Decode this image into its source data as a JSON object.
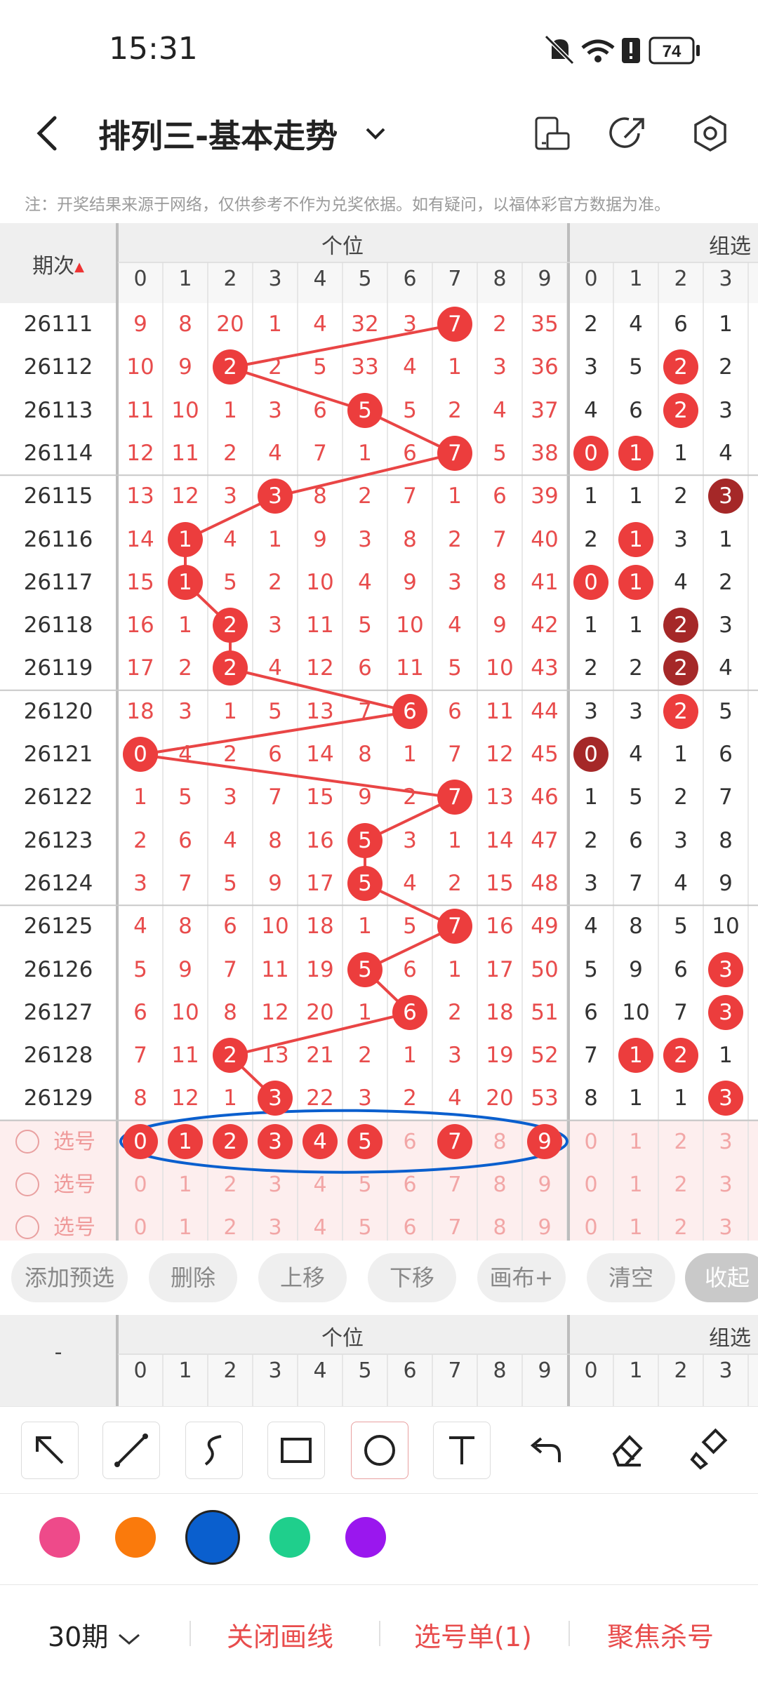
{
  "status_bar": {
    "time": "15:31",
    "battery": "74"
  },
  "header": {
    "title": "排列三-基本走势"
  },
  "note": "注：开奖结果来源于网络，仅供参考不作为兑奖依据。如有疑问，以福体彩官方数据为准。",
  "table": {
    "period_header": "期次",
    "group1_header": "个位",
    "group2_header": "组选",
    "digits": [
      "0",
      "1",
      "2",
      "3",
      "4",
      "5",
      "6",
      "7",
      "8",
      "9"
    ],
    "digits2": [
      "0",
      "1",
      "2",
      "3"
    ],
    "rows": [
      {
        "period": "26111",
        "vals": [
          "9",
          "8",
          "20",
          "1",
          "4",
          "32",
          "3",
          "7",
          "2",
          "35"
        ],
        "hit": 7,
        "vals2": [
          "2",
          "4",
          "6",
          "1"
        ],
        "hits2": []
      },
      {
        "period": "26112",
        "vals": [
          "10",
          "9",
          "2",
          "2",
          "5",
          "33",
          "4",
          "1",
          "3",
          "36"
        ],
        "hit": 2,
        "vals2": [
          "3",
          "5",
          "2",
          "2"
        ],
        "hits2": [
          2
        ]
      },
      {
        "period": "26113",
        "vals": [
          "11",
          "10",
          "1",
          "3",
          "6",
          "5",
          "5",
          "2",
          "4",
          "37"
        ],
        "hit": 5,
        "vals2": [
          "4",
          "6",
          "2",
          "3"
        ],
        "hits2": [
          2
        ]
      },
      {
        "period": "26114",
        "vals": [
          "12",
          "11",
          "2",
          "4",
          "7",
          "1",
          "6",
          "7",
          "5",
          "38"
        ],
        "hit": 7,
        "vals2": [
          "0",
          "1",
          "1",
          "4"
        ],
        "hits2": [
          0,
          1
        ]
      },
      {
        "period": "26115",
        "vals": [
          "13",
          "12",
          "3",
          "3",
          "8",
          "2",
          "7",
          "1",
          "6",
          "39"
        ],
        "hit": 3,
        "vals2": [
          "1",
          "1",
          "2",
          "3"
        ],
        "hits2": [
          3
        ],
        "dark2": [
          3
        ]
      },
      {
        "period": "26116",
        "vals": [
          "14",
          "1",
          "4",
          "1",
          "9",
          "3",
          "8",
          "2",
          "7",
          "40"
        ],
        "hit": 1,
        "vals2": [
          "2",
          "1",
          "3",
          "1"
        ],
        "hits2": [
          1
        ]
      },
      {
        "period": "26117",
        "vals": [
          "15",
          "1",
          "5",
          "2",
          "10",
          "4",
          "9",
          "3",
          "8",
          "41"
        ],
        "hit": 1,
        "vals2": [
          "0",
          "1",
          "4",
          "2"
        ],
        "hits2": [
          0,
          1
        ]
      },
      {
        "period": "26118",
        "vals": [
          "16",
          "1",
          "2",
          "3",
          "11",
          "5",
          "10",
          "4",
          "9",
          "42"
        ],
        "hit": 2,
        "vals2": [
          "1",
          "1",
          "2",
          "3"
        ],
        "hits2": [
          2
        ],
        "dark2": [
          2
        ]
      },
      {
        "period": "26119",
        "vals": [
          "17",
          "2",
          "2",
          "4",
          "12",
          "6",
          "11",
          "5",
          "10",
          "43"
        ],
        "hit": 2,
        "vals2": [
          "2",
          "2",
          "2",
          "4"
        ],
        "hits2": [
          2
        ],
        "dark2": [
          2
        ]
      },
      {
        "period": "26120",
        "vals": [
          "18",
          "3",
          "1",
          "5",
          "13",
          "7",
          "6",
          "6",
          "11",
          "44"
        ],
        "hit": 6,
        "vals2": [
          "3",
          "3",
          "2",
          "5"
        ],
        "hits2": [
          2
        ]
      },
      {
        "period": "26121",
        "vals": [
          "0",
          "4",
          "2",
          "6",
          "14",
          "8",
          "1",
          "7",
          "12",
          "45"
        ],
        "hit": 0,
        "vals2": [
          "0",
          "4",
          "1",
          "6"
        ],
        "hits2": [
          0
        ],
        "dark2": [
          0
        ]
      },
      {
        "period": "26122",
        "vals": [
          "1",
          "5",
          "3",
          "7",
          "15",
          "9",
          "2",
          "7",
          "13",
          "46"
        ],
        "hit": 7,
        "vals2": [
          "1",
          "5",
          "2",
          "7"
        ],
        "hits2": []
      },
      {
        "period": "26123",
        "vals": [
          "2",
          "6",
          "4",
          "8",
          "16",
          "5",
          "3",
          "1",
          "14",
          "47"
        ],
        "hit": 5,
        "vals2": [
          "2",
          "6",
          "3",
          "8"
        ],
        "hits2": []
      },
      {
        "period": "26124",
        "vals": [
          "3",
          "7",
          "5",
          "9",
          "17",
          "5",
          "4",
          "2",
          "15",
          "48"
        ],
        "hit": 5,
        "vals2": [
          "3",
          "7",
          "4",
          "9"
        ],
        "hits2": []
      },
      {
        "period": "26125",
        "vals": [
          "4",
          "8",
          "6",
          "10",
          "18",
          "1",
          "5",
          "7",
          "16",
          "49"
        ],
        "hit": 7,
        "vals2": [
          "4",
          "8",
          "5",
          "10"
        ],
        "hits2": []
      },
      {
        "period": "26126",
        "vals": [
          "5",
          "9",
          "7",
          "11",
          "19",
          "5",
          "6",
          "1",
          "17",
          "50"
        ],
        "hit": 5,
        "vals2": [
          "5",
          "9",
          "6",
          "3"
        ],
        "hits2": [
          3
        ]
      },
      {
        "period": "26127",
        "vals": [
          "6",
          "10",
          "8",
          "12",
          "20",
          "1",
          "6",
          "2",
          "18",
          "51"
        ],
        "hit": 6,
        "vals2": [
          "6",
          "10",
          "7",
          "3"
        ],
        "hits2": [
          3
        ]
      },
      {
        "period": "26128",
        "vals": [
          "7",
          "11",
          "2",
          "13",
          "21",
          "2",
          "1",
          "3",
          "19",
          "52"
        ],
        "hit": 2,
        "vals2": [
          "7",
          "1",
          "2",
          "1"
        ],
        "hits2": [
          1,
          2
        ]
      },
      {
        "period": "26129",
        "vals": [
          "8",
          "12",
          "1",
          "3",
          "22",
          "3",
          "2",
          "4",
          "20",
          "53"
        ],
        "hit": 3,
        "vals2": [
          "8",
          "1",
          "1",
          "3"
        ],
        "hits2": [
          3
        ]
      }
    ],
    "select_label": "选号",
    "select_row1_selected": [
      0,
      1,
      2,
      3,
      4,
      5,
      7,
      9
    ]
  },
  "toolbar": [
    "添加预选",
    "删除",
    "上移",
    "下移",
    "画布+",
    "清空",
    "收起"
  ],
  "bottom_table": {
    "row_label": "-",
    "group1_header": "个位",
    "group2_header": "组选"
  },
  "palette": [
    "#ee4a8a",
    "#fa7a0c",
    "#0a5fce",
    "#1fcf8c",
    "#9a17ee"
  ],
  "palette_selected": 2,
  "bottom": {
    "periods": "30期",
    "close_lines": "关闭画线",
    "selection_list": "选号单(1)",
    "focus_kill": "聚焦杀号"
  }
}
